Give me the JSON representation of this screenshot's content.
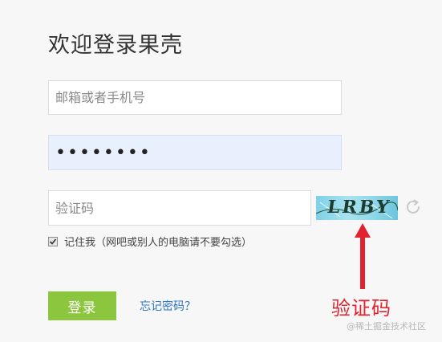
{
  "page": {
    "title": "欢迎登录果壳"
  },
  "form": {
    "email_placeholder": "邮箱或者手机号",
    "email_value": "",
    "password_value": "********",
    "captcha_placeholder": "验证码",
    "captcha_value": "",
    "captcha_image_text": "LRBY",
    "remember_label": "记住我（网吧或别人的电脑请不要勾选）",
    "remember_checked": true,
    "login_label": "登录",
    "forgot_label": "忘记密码？"
  },
  "annotation": {
    "label": "验证码",
    "color": "#e0232f"
  },
  "watermark": "@稀土掘金技术社区",
  "icons": {
    "refresh": "refresh-icon",
    "checkbox": "checkmark-icon",
    "arrow": "up-arrow-icon"
  },
  "colors": {
    "accent_green": "#8cc63f",
    "link_blue": "#2a75c8",
    "password_bg": "#e8effd"
  }
}
